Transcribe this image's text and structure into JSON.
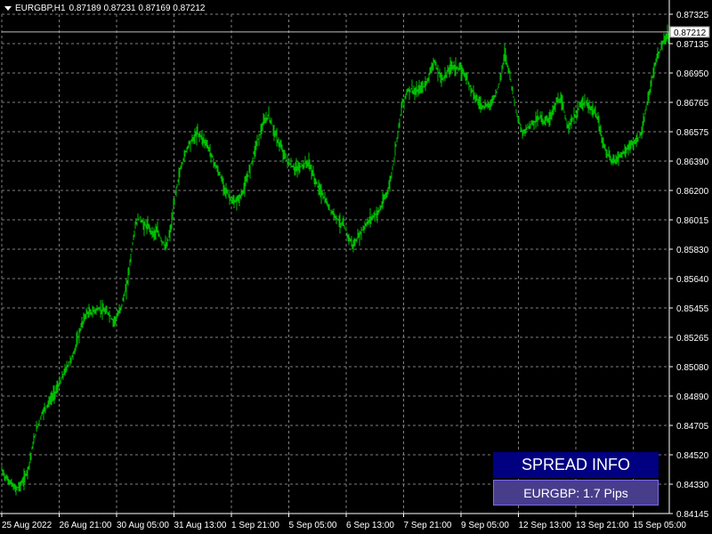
{
  "header": {
    "symbol_text": "EURGBP,H1",
    "ohlc_text": "0.87189 0.87231 0.87169 0.87212"
  },
  "spread_panel": {
    "title": "SPREAD INFO",
    "value": "EURGBP: 1.7 Pips",
    "title_bg": "#000080",
    "value_bg": "#483D8B"
  },
  "colors": {
    "background": "#000000",
    "grid": "#808080",
    "candles": "#00C000",
    "axis_text": "#FFFFFF"
  },
  "chart_data": {
    "type": "line",
    "symbol": "EURGBP",
    "timeframe": "H1",
    "current_price": 0.87212,
    "current_price_label": "0.87212",
    "ylim": [
      0.84145,
      0.87325
    ],
    "y_ticks": [
      "0.87325",
      "0.87135",
      "0.86950",
      "0.86765",
      "0.86575",
      "0.86390",
      "0.86200",
      "0.86015",
      "0.85830",
      "0.85640",
      "0.85455",
      "0.85265",
      "0.85080",
      "0.84890",
      "0.84705",
      "0.84520",
      "0.84330",
      "0.84145"
    ],
    "x_ticks": [
      "25 Aug 2022",
      "26 Aug 21:00",
      "30 Aug 05:00",
      "31 Aug 13:00",
      "1 Sep 21:00",
      "5 Sep 05:00",
      "6 Sep 13:00",
      "7 Sep 21:00",
      "9 Sep 05:00",
      "12 Sep 13:00",
      "13 Sep 21:00",
      "15 Sep 05:00"
    ],
    "grid": true,
    "series": [
      {
        "x": [
          0,
          5,
          10,
          15,
          20,
          25,
          30,
          35,
          40,
          45,
          50,
          55,
          60,
          65,
          70,
          75,
          80,
          85,
          90,
          95,
          100,
          105,
          110,
          115,
          120,
          125,
          130,
          135,
          140,
          145,
          150,
          155,
          160,
          165,
          170,
          175,
          180,
          185,
          190,
          195,
          200,
          205,
          210,
          215,
          220,
          225,
          230,
          235,
          240,
          245,
          250,
          255,
          260,
          265,
          270,
          275,
          280,
          285,
          290,
          295,
          300,
          305,
          310,
          315,
          320,
          325,
          330,
          335,
          340,
          345,
          350,
          355,
          360,
          365,
          370,
          375,
          380,
          385,
          390,
          395,
          400,
          405,
          410,
          415,
          420,
          425,
          430,
          435,
          440,
          445,
          450,
          455,
          460,
          465,
          470,
          475,
          480,
          485,
          490,
          495,
          500,
          505,
          510,
          515,
          520,
          525,
          530,
          535,
          540,
          545,
          550,
          555,
          560,
          565,
          570,
          575,
          580,
          585,
          590,
          595,
          600,
          605,
          610,
          615,
          620,
          625,
          630,
          635,
          640,
          645,
          650,
          655,
          660,
          665,
          670,
          675,
          680,
          685,
          690,
          695,
          700,
          705,
          710,
          715,
          720,
          725,
          730,
          735,
          740,
          745,
          750
        ],
        "y": [
          0.8442,
          0.8437,
          0.8434,
          0.843,
          0.8432,
          0.8436,
          0.8444,
          0.8458,
          0.847,
          0.8478,
          0.8483,
          0.8487,
          0.8492,
          0.8497,
          0.8504,
          0.851,
          0.8515,
          0.8525,
          0.8535,
          0.8542,
          0.8542,
          0.8544,
          0.8545,
          0.8543,
          0.8542,
          0.8537,
          0.854,
          0.8548,
          0.8558,
          0.8578,
          0.8598,
          0.8603,
          0.8598,
          0.8597,
          0.8593,
          0.8594,
          0.8588,
          0.8584,
          0.8596,
          0.8618,
          0.8632,
          0.8642,
          0.865,
          0.8653,
          0.8657,
          0.8654,
          0.865,
          0.8644,
          0.8636,
          0.863,
          0.8623,
          0.8617,
          0.8612,
          0.8614,
          0.8618,
          0.8626,
          0.8637,
          0.8648,
          0.8656,
          0.8664,
          0.8668,
          0.866,
          0.8652,
          0.8646,
          0.864,
          0.8636,
          0.8634,
          0.8635,
          0.8637,
          0.8638,
          0.863,
          0.8623,
          0.8618,
          0.8612,
          0.8607,
          0.8604,
          0.86,
          0.8597,
          0.859,
          0.8585,
          0.859,
          0.8595,
          0.8599,
          0.8603,
          0.8605,
          0.8608,
          0.8615,
          0.8622,
          0.8637,
          0.8658,
          0.8675,
          0.8683,
          0.8685,
          0.8682,
          0.8685,
          0.8687,
          0.8693,
          0.8703,
          0.8696,
          0.8691,
          0.8695,
          0.87,
          0.8699,
          0.8697,
          0.8695,
          0.8688,
          0.8683,
          0.8677,
          0.8674,
          0.8674,
          0.8676,
          0.8682,
          0.869,
          0.8708,
          0.8697,
          0.868,
          0.8666,
          0.8656,
          0.866,
          0.8663,
          0.8665,
          0.8667,
          0.8664,
          0.8666,
          0.8672,
          0.8678,
          0.8675,
          0.8662,
          0.8664,
          0.8668,
          0.8675,
          0.8676,
          0.8673,
          0.8671,
          0.8665,
          0.8652,
          0.8644,
          0.8639,
          0.864,
          0.8643,
          0.8645,
          0.8648,
          0.865,
          0.8653,
          0.8659,
          0.8675,
          0.869,
          0.8702,
          0.871,
          0.8716,
          0.8721
        ]
      }
    ]
  }
}
